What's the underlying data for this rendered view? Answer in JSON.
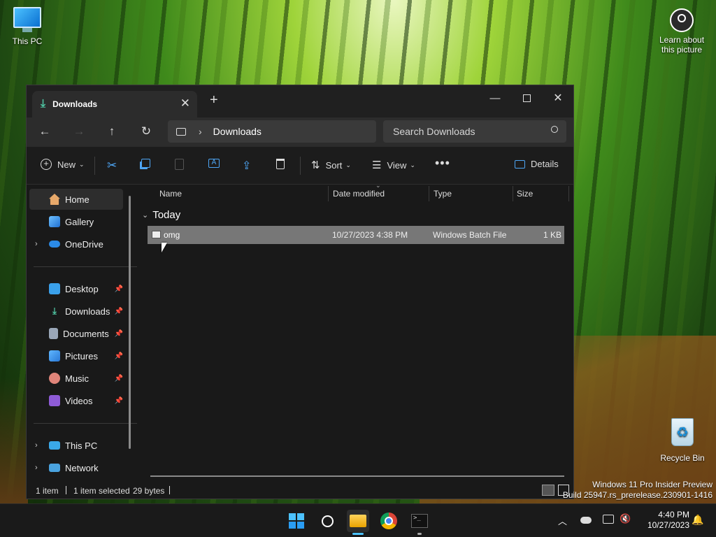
{
  "desktop": {
    "icons": {
      "this_pc": "This PC",
      "recycle_bin": "Recycle Bin",
      "learn_about_line1": "Learn about",
      "learn_about_line2": "this picture"
    },
    "watermark_line1": "Windows 11 Pro Insider Preview",
    "watermark_line2": "Build 25947.rs_prerelease.230901-1416"
  },
  "window": {
    "tab_title": "Downloads",
    "address": {
      "location": "Downloads"
    },
    "search_placeholder": "Search Downloads",
    "commandbar": {
      "new_label": "New",
      "sort_label": "Sort",
      "view_label": "View",
      "details_label": "Details"
    },
    "nav": {
      "home": "Home",
      "gallery": "Gallery",
      "onedrive": "OneDrive",
      "desktop": "Desktop",
      "downloads": "Downloads",
      "documents": "Documents",
      "pictures": "Pictures",
      "music": "Music",
      "videos": "Videos",
      "this_pc": "This PC",
      "network": "Network"
    },
    "columns": {
      "name": "Name",
      "date": "Date modified",
      "type": "Type",
      "size": "Size"
    },
    "group": "Today",
    "files": [
      {
        "name": "omg",
        "date": "10/27/2023 4:38 PM",
        "type": "Windows Batch File",
        "size": "1 KB"
      }
    ],
    "status": {
      "items": "1 item",
      "selected": "1 item selected",
      "bytes": "29 bytes"
    }
  },
  "taskbar": {
    "time": "4:40 PM",
    "date": "10/27/2023"
  },
  "colors": {
    "accent": "#0078d4",
    "selected_row": "#777777",
    "window_bg": "#191919"
  }
}
